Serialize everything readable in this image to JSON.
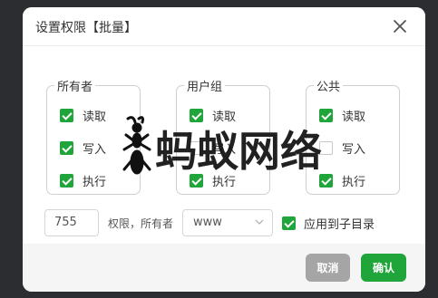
{
  "dialog": {
    "title": "设置权限【批量】",
    "close_icon": "close-icon"
  },
  "groups": [
    {
      "label": "所有者",
      "options": [
        {
          "label": "读取",
          "checked": true
        },
        {
          "label": "写入",
          "checked": true
        },
        {
          "label": "执行",
          "checked": true
        }
      ]
    },
    {
      "label": "用户组",
      "options": [
        {
          "label": "读取",
          "checked": true
        },
        {
          "label": "写入",
          "checked": false
        },
        {
          "label": "执行",
          "checked": true
        }
      ]
    },
    {
      "label": "公共",
      "options": [
        {
          "label": "读取",
          "checked": true
        },
        {
          "label": "写入",
          "checked": false
        },
        {
          "label": "执行",
          "checked": true
        }
      ]
    }
  ],
  "permission": {
    "value": "755",
    "text": "权限，所有者",
    "owner_selected": "www"
  },
  "apply_subdir": {
    "label": "应用到子目录",
    "checked": true
  },
  "buttons": {
    "cancel": "取消",
    "confirm": "确认"
  },
  "watermark": {
    "text": "蚂蚁网络"
  },
  "colors": {
    "accent": "#20a53a",
    "cancel": "#a5a5a5"
  }
}
